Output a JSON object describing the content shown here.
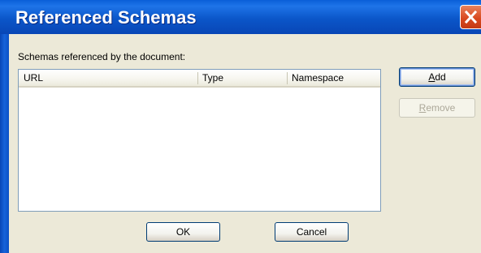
{
  "dialog": {
    "title": "Referenced Schemas"
  },
  "label": "Schemas referenced by the document:",
  "table": {
    "columns": [
      "URL",
      "Type",
      "Namespace"
    ],
    "rows": []
  },
  "buttons": {
    "add": {
      "mnemonic": "A",
      "rest": "dd",
      "enabled": true
    },
    "remove": {
      "mnemonic": "R",
      "rest": "emove",
      "enabled": false
    },
    "ok": "OK",
    "cancel": "Cancel"
  },
  "icons": {
    "close": "close-icon"
  },
  "colors": {
    "titlebar": "#0A5FD8",
    "close": "#D94A20",
    "dialog_bg": "#ECE9D8",
    "list_border": "#7F9DB9"
  }
}
